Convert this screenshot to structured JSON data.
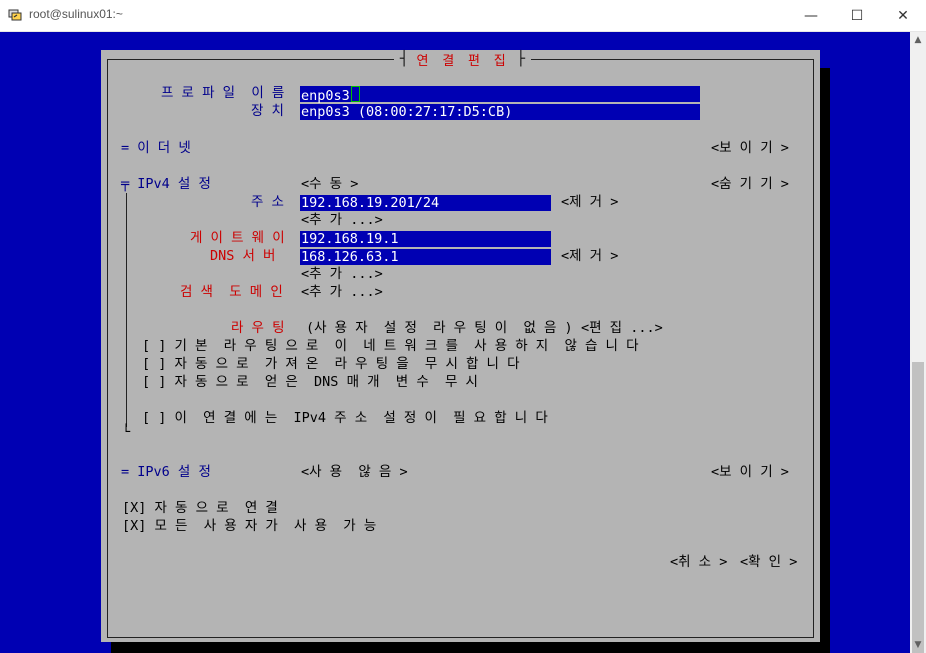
{
  "window": {
    "title": "root@sulinux01:~",
    "minimize": "—",
    "maximize": "☐",
    "close": "✕"
  },
  "dialog": {
    "title": "연 결  편 집",
    "profile_label": "프 로 파 일  이 름",
    "profile_value": "enp0s3",
    "device_label": "장 치",
    "device_value": "enp0s3 (08:00:27:17:D5:CB)",
    "ethernet_label": "= 이 더 넷",
    "ethernet_toggle": "<보 이 기 >",
    "ipv4_label": "╤ IPv4 설 정",
    "ipv4_mode": "<수 동 >",
    "ipv4_toggle": "<숨 기 기 >",
    "address_label": "주 소",
    "address_value": "192.168.19.201/24",
    "address_remove": "<제 거 >",
    "address_add": "<추 가 ...>",
    "gateway_label": "게 이 트 웨 이",
    "gateway_value": "192.168.19.1",
    "dns_label": "DNS 서 버",
    "dns_value": "168.126.63.1",
    "dns_remove": "<제 거 >",
    "dns_add": "<추 가 ...>",
    "search_label": "검 색  도 메 인",
    "search_add": "<추 가 ...>",
    "routing_label": "라 우 팅",
    "routing_value": "(사 용 자  설 정  라 우 팅 이  없 음 )",
    "routing_edit": "<편 집 ...>",
    "opt_default_route": "[ ] 기 본  라 우 팅 으 로  이  네 트 워 크 를  사 용 하 지  않 습 니 다",
    "opt_ignore_routes": "[ ] 자 동 으 로  가 져 온  라 우 팅 을  무 시 합 니 다",
    "opt_ignore_dns": "[ ] 자 동 으 로  얻 은  DNS 매 개  변 수  무 시",
    "opt_require_ipv4": "[ ] 이  연 결 에 는  IPv4 주 소  설 정 이  필 요 합 니 다",
    "ipv6_label": "= IPv6 설 정",
    "ipv6_mode": "<사 용  않 음 >",
    "ipv6_toggle": "<보 이 기 >",
    "auto_connect": "[X] 자 동 으 로  연 결",
    "all_users": "[X] 모 든  사 용 자 가  사 용  가 능",
    "cancel": "<취 소 >",
    "ok": "<확 인 >"
  }
}
